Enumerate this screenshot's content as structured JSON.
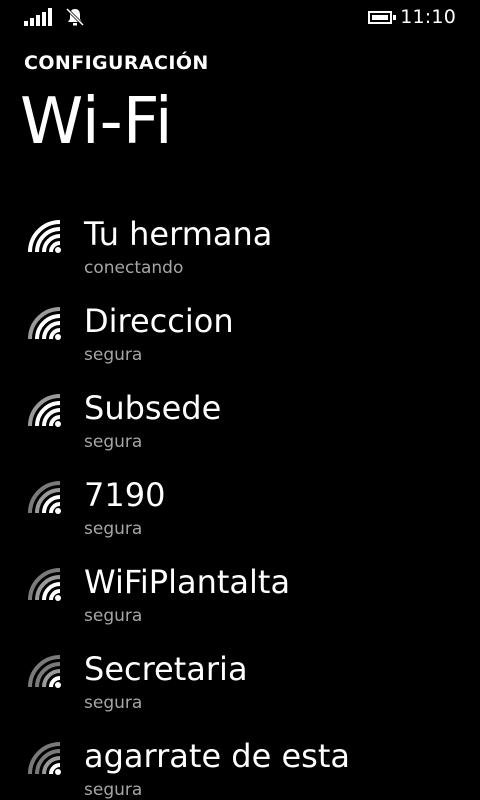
{
  "status_bar": {
    "signal_icon": "signal-strength-icon",
    "notification_icon": "quiet-hours-bell-icon",
    "battery_icon": "battery-icon",
    "time": "11:10"
  },
  "header": {
    "app_title": "CONFIGURACIÓN",
    "page_title": "Wi-Fi"
  },
  "colors": {
    "background": "#000000",
    "text": "#ffffff",
    "secondary_text": "#a6a6a6"
  },
  "networks": [
    {
      "name": "Tu hermana",
      "status": "conectando",
      "icon": "wifi-signal-icon"
    },
    {
      "name": "Direccion",
      "status": "segura",
      "icon": "wifi-secure-icon"
    },
    {
      "name": "Subsede",
      "status": "segura",
      "icon": "wifi-secure-icon"
    },
    {
      "name": "7190",
      "status": "segura",
      "icon": "wifi-secure-icon"
    },
    {
      "name": "WiFiPlantalta",
      "status": "segura",
      "icon": "wifi-secure-icon"
    },
    {
      "name": "Secretaria",
      "status": "segura",
      "icon": "wifi-secure-icon"
    },
    {
      "name": "agarrate de esta",
      "status": "segura",
      "icon": "wifi-secure-icon"
    }
  ]
}
